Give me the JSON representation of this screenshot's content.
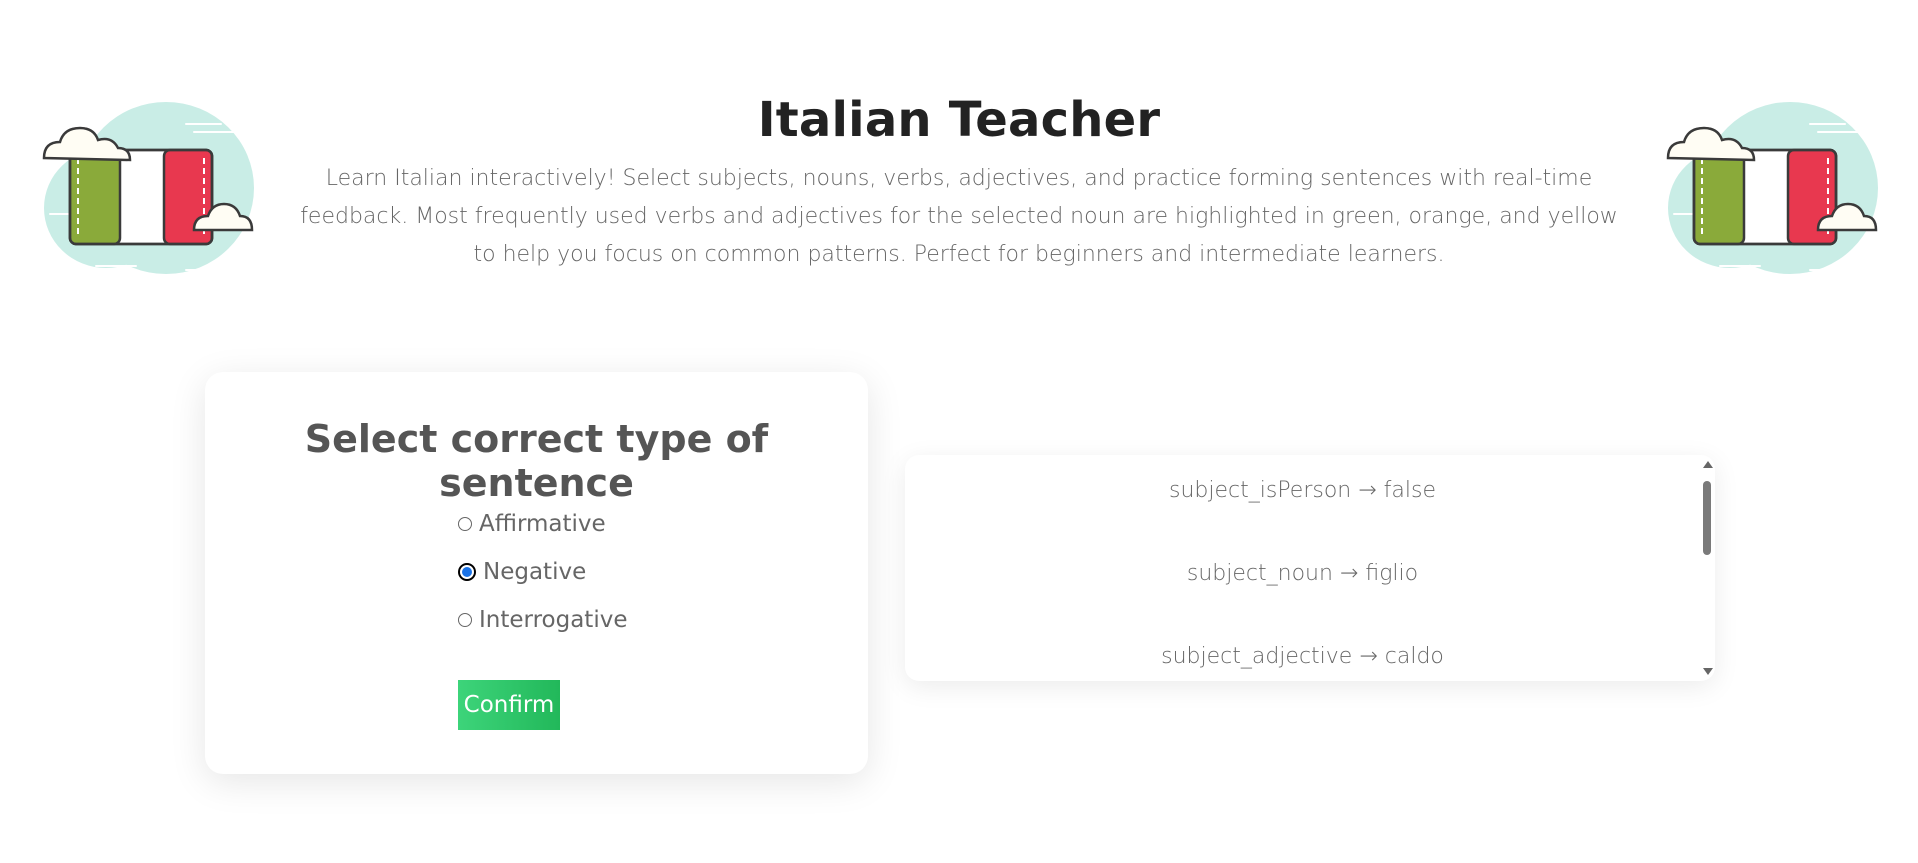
{
  "header": {
    "title": "Italian Teacher",
    "description": "Learn Italian interactively! Select subjects, nouns, verbs, adjectives, and practice forming sentences with real-time feedback. Most frequently used verbs and adjectives for the selected noun are highlighted in green, orange, and yellow to help you focus on common patterns. Perfect for beginners and intermediate learners.",
    "logo_icon": "italian-flag-cloud-icon"
  },
  "form": {
    "title": "Select correct type of sentence",
    "options": [
      {
        "label": "Affirmative",
        "checked": false
      },
      {
        "label": "Negative",
        "checked": true
      },
      {
        "label": "Interrogative",
        "checked": false
      }
    ],
    "confirm_label": "Confirm"
  },
  "results": {
    "items": [
      "subject_isPerson → false",
      "subject_noun → figlio",
      "subject_adjective → caldo"
    ]
  },
  "colors": {
    "flag_green": "#8aaa3a",
    "flag_red": "#e8384f",
    "cloud": "#c9ede6",
    "confirm": "#2fc86b",
    "radio_selected": "#1a73e8"
  }
}
